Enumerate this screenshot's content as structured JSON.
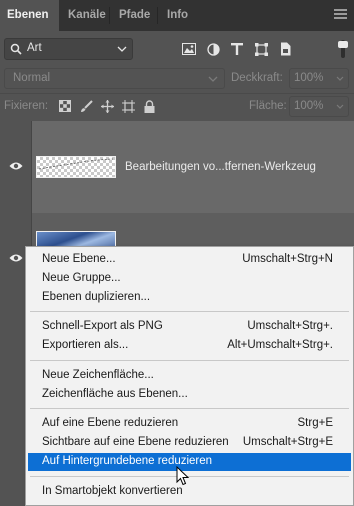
{
  "tabs": [
    {
      "label": "Ebenen"
    },
    {
      "label": "Kanäle"
    },
    {
      "label": "Pfade"
    },
    {
      "label": "Info"
    }
  ],
  "filter": {
    "kind_label": "Art",
    "icons": [
      "pixel-filter-icon",
      "adjustment-filter-icon",
      "type-filter-icon",
      "shape-filter-icon",
      "smartobject-filter-icon"
    ]
  },
  "blend": {
    "mode": "Normal",
    "opacity_label": "Deckkraft:",
    "opacity_value": "100%"
  },
  "lock": {
    "label": "Fixieren:",
    "icons": [
      "lock-transparent-icon",
      "lock-image-icon",
      "lock-position-icon",
      "lock-artboard-icon",
      "lock-all-icon"
    ],
    "fill_label": "Fläche:",
    "fill_value": "100%"
  },
  "layers": [
    {
      "name": "Bearbeitungen vo...tfernen-Werkzeug",
      "visible": true
    },
    {
      "name": "",
      "visible": true
    }
  ],
  "context_menu": {
    "items": [
      {
        "label": "Neue Ebene...",
        "shortcut": "Umschalt+Strg+N"
      },
      {
        "label": "Neue Gruppe...",
        "shortcut": ""
      },
      {
        "label": "Ebenen duplizieren...",
        "shortcut": ""
      },
      {
        "label": "Schnell-Export als PNG",
        "shortcut": "Umschalt+Strg+."
      },
      {
        "label": "Exportieren als...",
        "shortcut": "Alt+Umschalt+Strg+."
      },
      {
        "label": "Neue Zeichenfläche...",
        "shortcut": ""
      },
      {
        "label": "Zeichenfläche aus Ebenen...",
        "shortcut": ""
      },
      {
        "label": "Auf eine Ebene reduzieren",
        "shortcut": "Strg+E"
      },
      {
        "label": "Sichtbare auf eine Ebene reduzieren",
        "shortcut": "Umschalt+Strg+E"
      },
      {
        "label": "Auf Hintergrundebene reduzieren",
        "shortcut": ""
      },
      {
        "label": "In Smartobjekt konvertieren",
        "shortcut": ""
      }
    ],
    "highlighted": "Auf Hintergrundebene reduzieren",
    "highlight_color": "#0d6fd4"
  }
}
